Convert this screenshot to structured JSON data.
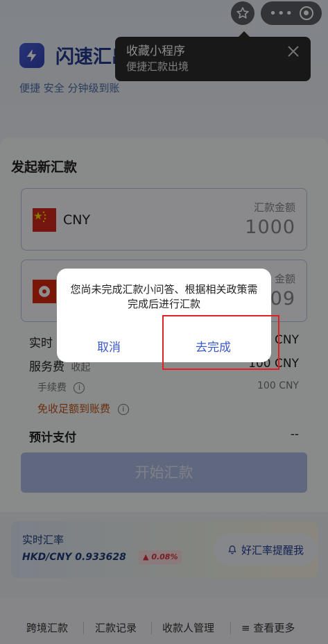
{
  "top_bar": {
    "star_icon": "star-icon",
    "more_icon": "more-dots-icon",
    "close_miniapp_icon": "target-icon"
  },
  "brand": {
    "title": "闪速汇出境",
    "subtitle": "便捷 安全 分钟级到账"
  },
  "fav_tip": {
    "title": "收藏小程序",
    "subtitle": "便捷汇款出境"
  },
  "remit": {
    "section_title": "发起新汇款",
    "from": {
      "currency": "CNY",
      "amount_label": "汇款金额",
      "amount": "1000"
    },
    "to": {
      "currency": "",
      "amount_label": "金额",
      "amount": "09"
    },
    "rate_label": "实时",
    "rate_value": "CNY",
    "service_label": "服务费",
    "service_sub": "收起",
    "service_value": "100 CNY",
    "fee_label": "手续费",
    "fee_value": "100 CNY",
    "free_label": "免收足额到账费",
    "pay_label": "预计支付",
    "pay_value": "--",
    "start_button": "开始汇款"
  },
  "rate_card": {
    "title": "实时汇率",
    "pair": "HKD/CNY 0.933628",
    "change": "0.08%",
    "remind_button": "好汇率提醒我"
  },
  "bottom_nav": {
    "items": [
      "跨境汇款",
      "汇款记录",
      "收款人管理",
      "查看更多"
    ]
  },
  "dialog": {
    "message": "您尚未完成汇款小问答、根据相关政策需完成后进行汇款",
    "cancel": "取消",
    "confirm": "去完成"
  },
  "colors": {
    "brand": "#243a8f",
    "accent": "#3a58c8",
    "highlight": "#e02020",
    "down_red": "#d9363e"
  }
}
